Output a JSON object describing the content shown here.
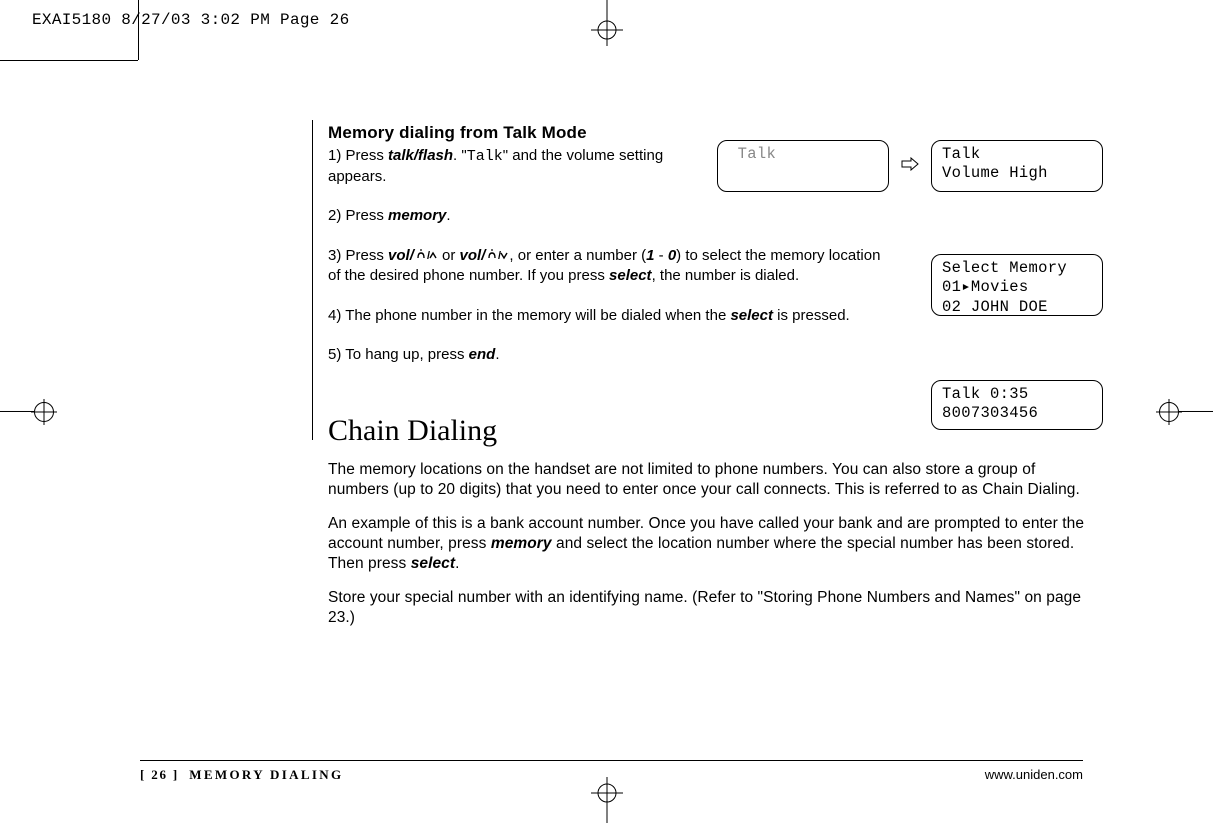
{
  "slug": "EXAI5180  8/27/03 3:02 PM  Page 26",
  "section1": {
    "title": "Memory dialing from Talk Mode",
    "step1_a": "1) Press ",
    "step1_btn": "talk/flash",
    "step1_b": ". \"",
    "step1_lcd": "Talk",
    "step1_c": "\" and the volume setting appears.",
    "step2_a": "2) Press ",
    "step2_btn": "memory",
    "step2_b": ".",
    "step3_a": "3) Press ",
    "step3_btn1": "vol/",
    "step3_mid": " or ",
    "step3_btn2": "vol/",
    "step3_b": ", or enter a number (",
    "step3_range1": "1",
    "step3_dash": " - ",
    "step3_range0": "0",
    "step3_c": ") to select the memory location of the desired phone number. If you press ",
    "step3_btn3": "select",
    "step3_d": ", the number is dialed.",
    "step4_a": "4) The phone number in the memory will be dialed when the ",
    "step4_btn": "select",
    "step4_b": " is pressed.",
    "step5_a": "5) To hang up, press ",
    "step5_btn": "end",
    "step5_b": "."
  },
  "screens": {
    "s1_l1": "Talk",
    "s2_l1": " Talk",
    "s2_l2": " Volume High",
    "s3_l1": " Select Memory",
    "s3_l2": "01▸Movies",
    "s3_l3": "02 JOHN DOE",
    "s4_l1": "  Talk    0:35",
    "s4_l2": "8007303456"
  },
  "section2": {
    "title": "Chain Dialing",
    "p1": "The memory locations on the handset are not limited to phone numbers. You can also store a group of numbers (up to 20 digits) that you need to enter once your call connects. This is referred to as Chain Dialing.",
    "p2_a": "An example of this is a bank account number. Once you have called your bank and are prompted to enter the account number, press ",
    "p2_btn1": "memory",
    "p2_b": " and select the location number where the special number has been stored. Then press ",
    "p2_btn2": "select",
    "p2_c": ".",
    "p3": "Store your special number with an identifying name. (Refer to \"Storing Phone Numbers and Names\" on page 23.)"
  },
  "footer": {
    "page": "[ 26 ]",
    "section": "MEMORY DIALING",
    "url": "www.uniden.com"
  }
}
